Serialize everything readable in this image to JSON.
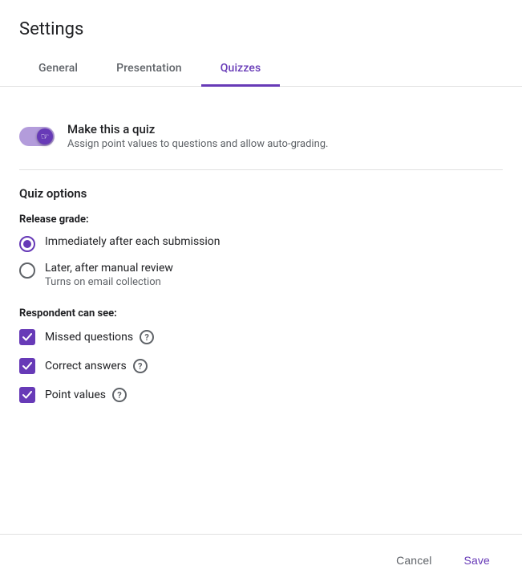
{
  "page": {
    "title": "Settings"
  },
  "tabs": [
    {
      "id": "general",
      "label": "General",
      "active": false
    },
    {
      "id": "presentation",
      "label": "Presentation",
      "active": false
    },
    {
      "id": "quizzes",
      "label": "Quizzes",
      "active": true
    }
  ],
  "quiz_toggle": {
    "title": "Make this a quiz",
    "subtitle": "Assign point values to questions and allow auto-grading.",
    "enabled": true
  },
  "quiz_options": {
    "heading": "Quiz options",
    "release_grade": {
      "label": "Release grade:",
      "options": [
        {
          "id": "immediately",
          "label": "Immediately after each submission",
          "sublabel": "",
          "selected": true
        },
        {
          "id": "later",
          "label": "Later, after manual review",
          "sublabel": "Turns on email collection",
          "selected": false
        }
      ]
    },
    "respondent_can_see": {
      "label": "Respondent can see:",
      "options": [
        {
          "id": "missed",
          "label": "Missed questions",
          "checked": true
        },
        {
          "id": "correct",
          "label": "Correct answers",
          "checked": true
        },
        {
          "id": "points",
          "label": "Point values",
          "checked": true
        }
      ]
    }
  },
  "footer": {
    "cancel_label": "Cancel",
    "save_label": "Save"
  },
  "colors": {
    "accent": "#673ab7"
  }
}
